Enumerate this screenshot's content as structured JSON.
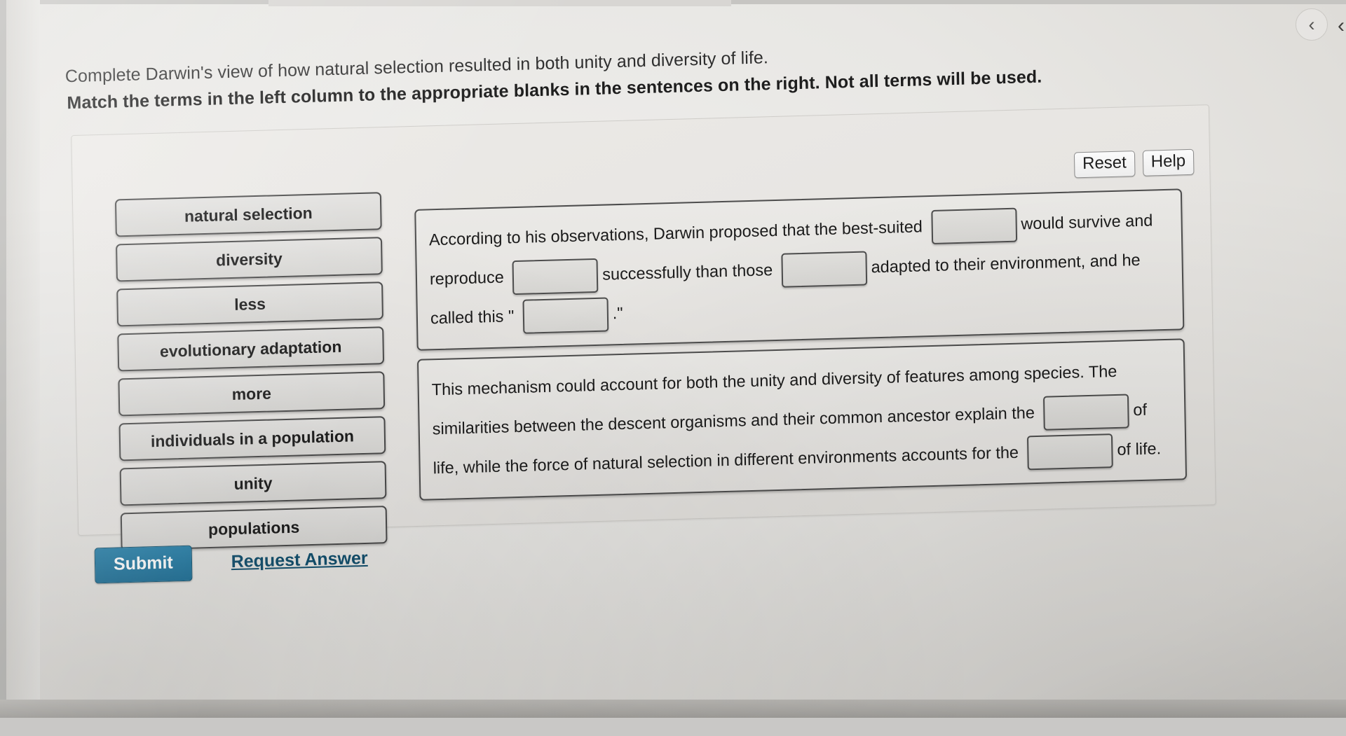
{
  "prompt": {
    "line1": "Complete Darwin's view of how natural selection resulted in both unity and diversity of life.",
    "line2": "Match the terms in the left column to the appropriate blanks in the sentences on the right. Not all terms will be used."
  },
  "toolbar": {
    "reset_label": "Reset",
    "help_label": "Help"
  },
  "terms": [
    {
      "label": "natural selection"
    },
    {
      "label": "diversity"
    },
    {
      "label": "less"
    },
    {
      "label": "evolutionary adaptation"
    },
    {
      "label": "more"
    },
    {
      "label": "individuals in a population"
    },
    {
      "label": "unity"
    },
    {
      "label": "populations"
    }
  ],
  "sentences": [
    {
      "id": "sentence-1",
      "segments": [
        {
          "type": "text",
          "value": "According to his observations, Darwin proposed that the best-suited"
        },
        {
          "type": "blank",
          "value": ""
        },
        {
          "type": "text",
          "value": "would survive and reproduce"
        },
        {
          "type": "blank",
          "value": ""
        },
        {
          "type": "text",
          "value": "successfully than those"
        },
        {
          "type": "blank",
          "value": ""
        },
        {
          "type": "text",
          "value": "adapted to their environment, and he called this \""
        },
        {
          "type": "blank",
          "value": ""
        },
        {
          "type": "text",
          "value": ".\""
        }
      ]
    },
    {
      "id": "sentence-2",
      "segments": [
        {
          "type": "text",
          "value": "This mechanism could account for both the unity and diversity of features among species. The similarities between the descent organisms and their common ancestor explain the"
        },
        {
          "type": "blank",
          "value": ""
        },
        {
          "type": "text",
          "value": "of life, while the force of natural selection in different environments accounts for the"
        },
        {
          "type": "blank",
          "value": ""
        },
        {
          "type": "text",
          "value": "of life."
        }
      ]
    }
  ],
  "footer": {
    "submit_label": "Submit",
    "request_answer_label": "Request Answer"
  },
  "nav": {
    "back_glyph": "‹",
    "corner_glyph": "‹"
  },
  "colors": {
    "submit_blue": "#1d6f96",
    "link_blue": "#13506e",
    "term_border": "#4a4a4a",
    "page_bg": "#e8e7e4"
  }
}
